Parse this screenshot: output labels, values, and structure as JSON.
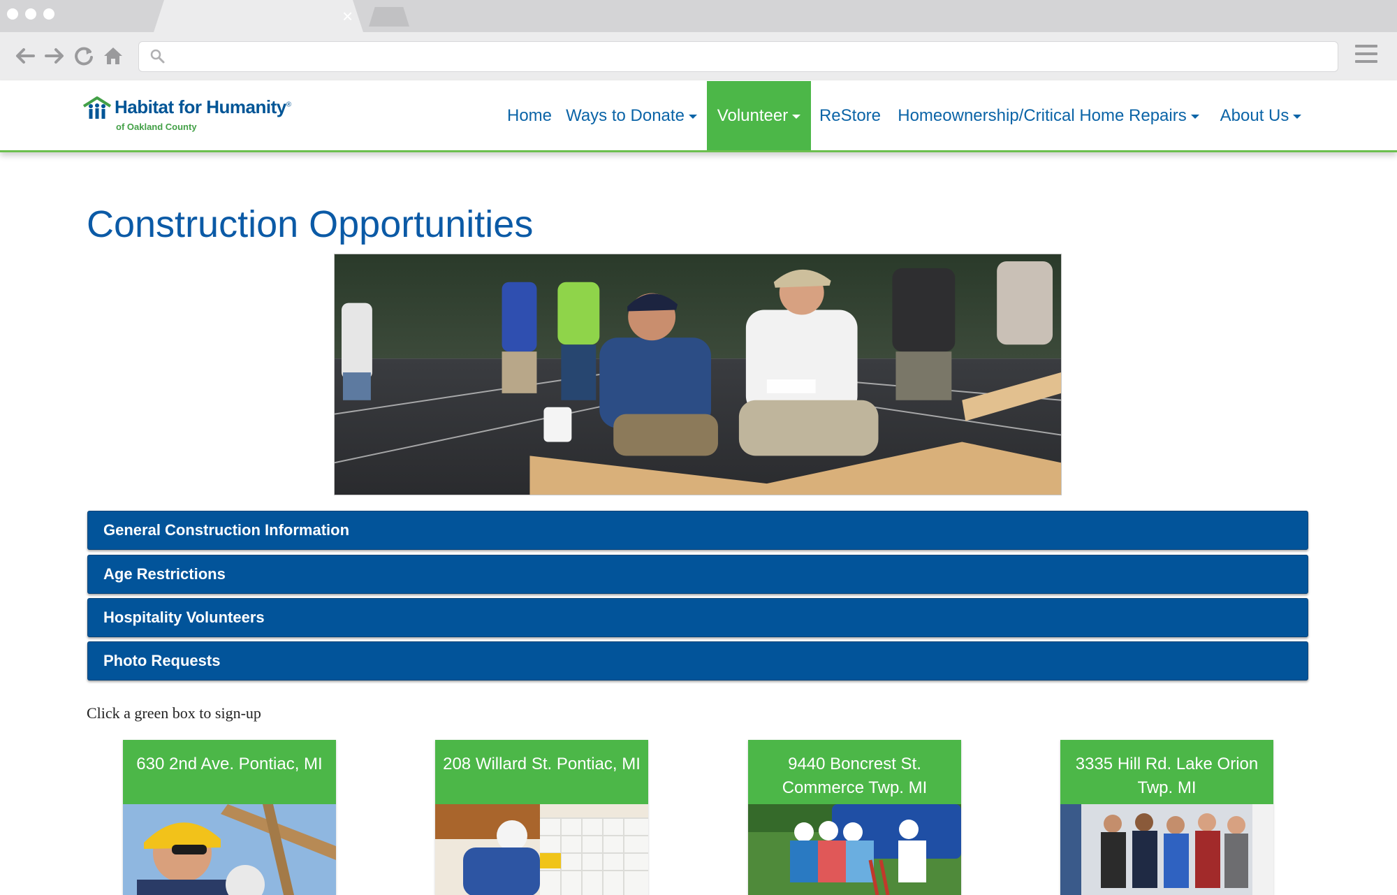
{
  "browser": {
    "tab_close_glyph": "×",
    "url": "",
    "icons": [
      "back-icon",
      "forward-icon",
      "reload-icon",
      "home-icon",
      "search-icon",
      "menu-icon"
    ]
  },
  "site": {
    "logo": {
      "name": "Habitat for Humanity",
      "registered": "®",
      "sub": "of Oakland County"
    },
    "nav": [
      {
        "label": "Home",
        "dropdown": false,
        "active": false
      },
      {
        "label": "Ways to Donate",
        "dropdown": true,
        "active": false
      },
      {
        "label": "Volunteer",
        "dropdown": true,
        "active": true
      },
      {
        "label": "ReStore",
        "dropdown": false,
        "active": false
      },
      {
        "label": "Homeownership/Critical Home Repairs",
        "dropdown": true,
        "active": false
      },
      {
        "label": "About Us",
        "dropdown": true,
        "active": false
      }
    ],
    "colors": {
      "brand_blue": "#02549a",
      "link_blue": "#0b64a7",
      "brand_green": "#4cb748"
    }
  },
  "main": {
    "title": "Construction Opportunities",
    "accordions": [
      "General Construction Information",
      "Age Restrictions",
      "Hospitality Volunteers",
      "Photo Requests"
    ],
    "hint": "Click a green box to sign-up",
    "cards": [
      {
        "address": "630 2nd Ave. Pontiac, MI"
      },
      {
        "address": "208 Willard St. Pontiac, MI"
      },
      {
        "address": "9440 Boncrest St. Commerce Twp. MI"
      },
      {
        "address": "3335 Hill Rd. Lake Orion Twp. MI"
      }
    ]
  }
}
